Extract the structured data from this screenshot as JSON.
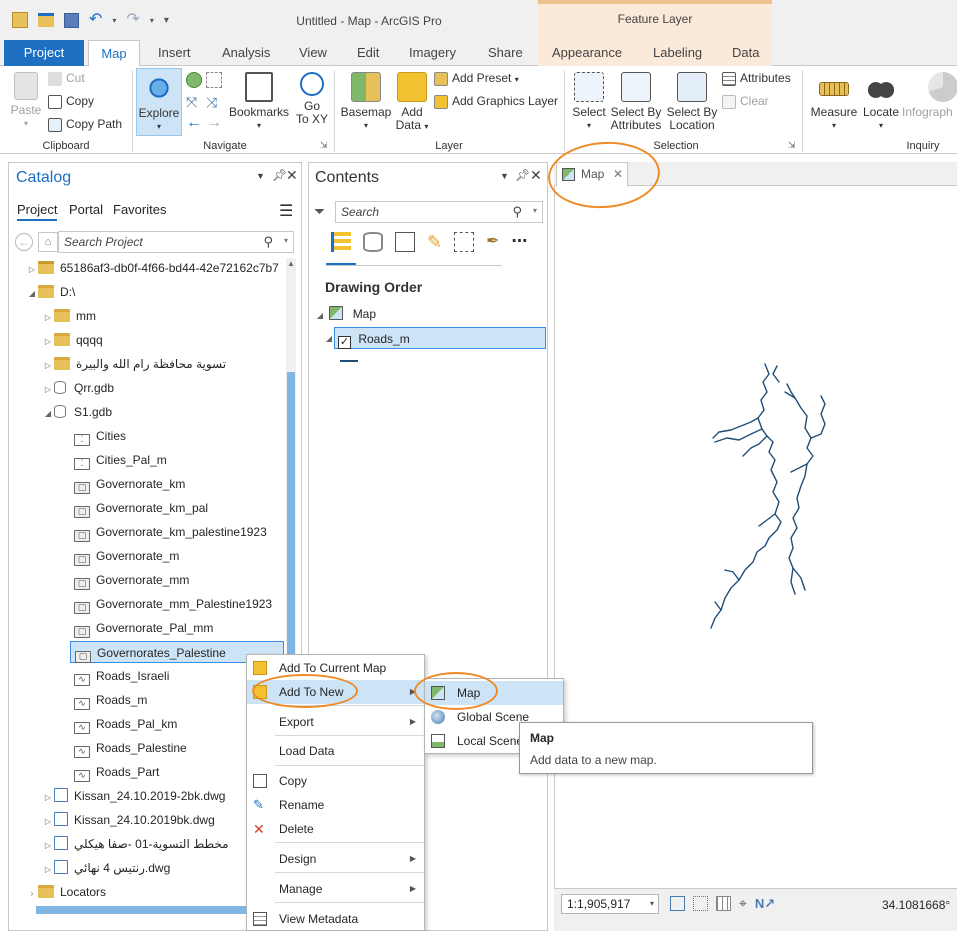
{
  "app": {
    "title": "Untitled - Map - ArcGIS Pro",
    "context_header": "Feature Layer"
  },
  "tabs": {
    "project": "Project",
    "items": [
      "Map",
      "Insert",
      "Analysis",
      "View",
      "Edit",
      "Imagery",
      "Share"
    ],
    "context_items": [
      "Appearance",
      "Labeling",
      "Data"
    ]
  },
  "ribbon": {
    "clipboard": {
      "label": "Clipboard",
      "paste": "Paste",
      "cut": "Cut",
      "copy": "Copy",
      "copy_path": "Copy Path"
    },
    "navigate": {
      "label": "Navigate",
      "explore": "Explore",
      "bookmarks": "Bookmarks",
      "go_to_xy_1": "Go",
      "go_to_xy_2": "To XY"
    },
    "layer": {
      "label": "Layer",
      "basemap": "Basemap",
      "add_data_1": "Add",
      "add_data_2": "Data",
      "add_preset": "Add Preset",
      "add_graphics_layer": "Add Graphics Layer"
    },
    "selection": {
      "label": "Selection",
      "select": "Select",
      "select_by_attr_1": "Select By",
      "select_by_attr_2": "Attributes",
      "select_by_loc_1": "Select By",
      "select_by_loc_2": "Location",
      "attributes": "Attributes",
      "clear": "Clear"
    },
    "inquiry": {
      "label": "Inquiry",
      "measure": "Measure",
      "locate": "Locate",
      "infographics": "Infograph"
    }
  },
  "catalog": {
    "title": "Catalog",
    "tabs": [
      "Project",
      "Portal",
      "Favorites"
    ],
    "search_placeholder": "Search Project",
    "items": [
      {
        "label": "65186af3-db0f-4f66-bd44-42e72162c7b7",
        "type": "folder-special",
        "level": 0,
        "exp": "▷"
      },
      {
        "label": "D:\\",
        "type": "folder",
        "level": 0,
        "exp": "◢"
      },
      {
        "label": "mm",
        "type": "folder",
        "level": 1,
        "exp": "▷"
      },
      {
        "label": "qqqq",
        "type": "folder",
        "level": 1,
        "exp": "▷"
      },
      {
        "label": "تسوية محافظة رام الله والبيرة",
        "type": "folder",
        "level": 1,
        "exp": "▷"
      },
      {
        "label": "Qrr.gdb",
        "type": "gdb",
        "level": 1,
        "exp": "▷"
      },
      {
        "label": "S1.gdb",
        "type": "gdb",
        "level": 1,
        "exp": "◢"
      },
      {
        "label": "Cities",
        "type": "point",
        "level": 2,
        "exp": ""
      },
      {
        "label": "Cities_Pal_m",
        "type": "point",
        "level": 2,
        "exp": ""
      },
      {
        "label": "Governorate_km",
        "type": "poly",
        "level": 2,
        "exp": ""
      },
      {
        "label": "Governorate_km_pal",
        "type": "poly",
        "level": 2,
        "exp": ""
      },
      {
        "label": "Governorate_km_palestine1923",
        "type": "poly",
        "level": 2,
        "exp": ""
      },
      {
        "label": "Governorate_m",
        "type": "poly",
        "level": 2,
        "exp": ""
      },
      {
        "label": "Governorate_mm",
        "type": "poly",
        "level": 2,
        "exp": ""
      },
      {
        "label": "Governorate_mm_Palestine1923",
        "type": "poly",
        "level": 2,
        "exp": ""
      },
      {
        "label": "Governorate_Pal_mm",
        "type": "poly",
        "level": 2,
        "exp": ""
      },
      {
        "label": "Governorates_Palestine",
        "type": "poly",
        "level": 2,
        "exp": "",
        "selected": true
      },
      {
        "label": "Roads_Israeli",
        "type": "line",
        "level": 2,
        "exp": ""
      },
      {
        "label": "Roads_m",
        "type": "line",
        "level": 2,
        "exp": ""
      },
      {
        "label": "Roads_Pal_km",
        "type": "line",
        "level": 2,
        "exp": ""
      },
      {
        "label": "Roads_Palestine",
        "type": "line",
        "level": 2,
        "exp": ""
      },
      {
        "label": "Roads_Part",
        "type": "line",
        "level": 2,
        "exp": ""
      },
      {
        "label": "Kissan_24.10.2019-2bk.dwg",
        "type": "cad",
        "level": 1,
        "exp": "▷"
      },
      {
        "label": "Kissan_24.10.2019bk.dwg",
        "type": "cad",
        "level": 1,
        "exp": "▷"
      },
      {
        "label": "مخطط التسوية-01 -صفا هيكلي",
        "type": "cad",
        "level": 1,
        "exp": "▷"
      },
      {
        "label": "رنتيس 4 نهائي.dwg",
        "type": "cad",
        "level": 1,
        "exp": "▷"
      },
      {
        "label": "Locators",
        "type": "folder",
        "level": 0,
        "exp": "›"
      }
    ]
  },
  "contents": {
    "title": "Contents",
    "search_placeholder": "Search",
    "drawing_order": "Drawing Order",
    "map_label": "Map",
    "layer_label": "Roads_m"
  },
  "map_view": {
    "tab_label": "Map",
    "scale": "1:1,905,917",
    "coords": "34.1081668°"
  },
  "context_menu": {
    "items": [
      "Add To Current Map",
      "Add To New",
      "Export",
      "Load Data",
      "Copy",
      "Rename",
      "Delete",
      "Design",
      "Manage",
      "View Metadata"
    ]
  },
  "submenu": {
    "items": [
      "Map",
      "Global Scene",
      "Local Scene"
    ]
  },
  "tooltip": {
    "title": "Map",
    "text": "Add data to a new map."
  },
  "colors": {
    "accent": "#1d6fc2",
    "context_tab": "#fbe9d9",
    "annotation": "#f08a24",
    "road_line": "#1f4e79"
  }
}
